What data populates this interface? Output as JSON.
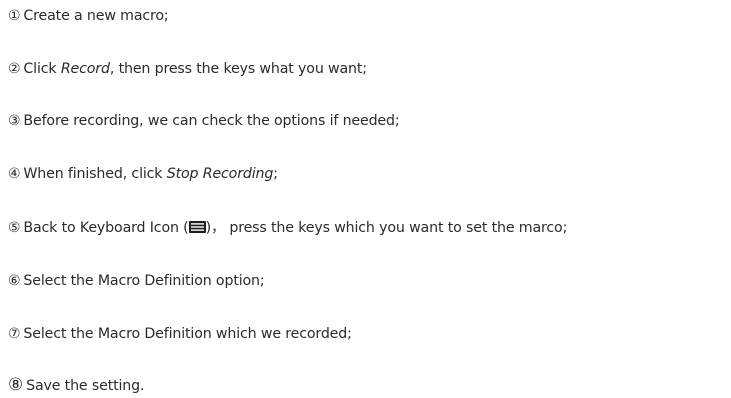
{
  "steps": [
    {
      "num": "①",
      "text": "Create a new macro;"
    },
    {
      "num": "②",
      "pre": "Click ",
      "em": "Record",
      "post": ", then press the keys what you want;"
    },
    {
      "num": "③",
      "text": "Before recording, we can check the options if needed;"
    },
    {
      "num": "④",
      "pre": "When finished, click ",
      "em": "Stop Recording",
      "post": ";"
    },
    {
      "num": "⑤",
      "pre": "Back to Keyboard Icon (",
      "icon": "keyboard-icon",
      "post": ")， press the keys which you want to set the marco;"
    },
    {
      "num": "⑥",
      "text": "Select the Macro Definition option;"
    },
    {
      "num": "⑦",
      "text": "Select the Macro Definition which we recorded;"
    },
    {
      "num": "⑧",
      "text": "Save the setting."
    }
  ],
  "colors": {
    "text": "#2b2b2b",
    "icon": "#1f1f1f"
  }
}
